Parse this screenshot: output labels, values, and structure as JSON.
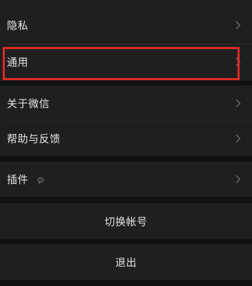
{
  "settings": {
    "privacy_label": "隐私",
    "general_label": "通用",
    "about_label": "关于微信",
    "help_label": "帮助与反馈",
    "plugins_label": "插件",
    "switch_account_label": "切换帐号",
    "logout_label": "退出"
  },
  "icons": {
    "chevron": "chevron-right-icon",
    "plugin_badge": "chat-bubble-icon"
  },
  "colors": {
    "background": "#111111",
    "cell": "#1f1f1f",
    "text": "#e6e6e6",
    "chevron": "#6d6d6d",
    "highlight": "#e02a23"
  }
}
